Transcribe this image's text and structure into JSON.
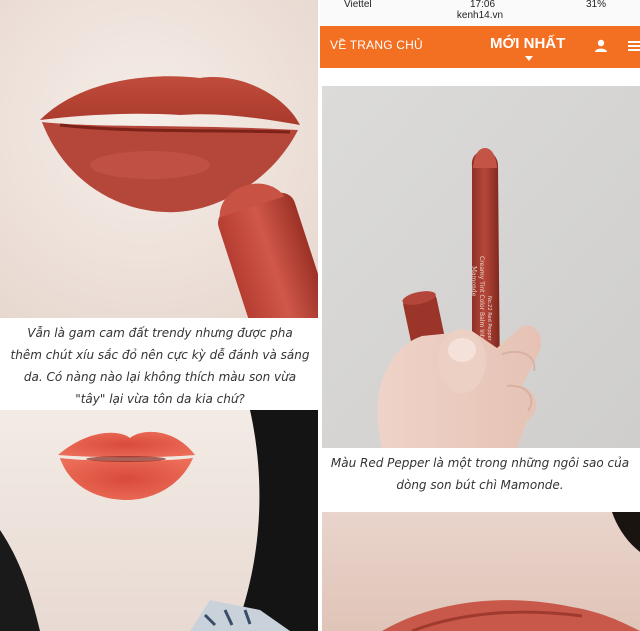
{
  "status_bar": {
    "carrier": "Viettel",
    "time": "17:06",
    "battery": "31%"
  },
  "url_bar": {
    "domain": "kenh14.vn"
  },
  "nav": {
    "home_label": "VỀ TRANG CHỦ",
    "newest_label": "MỚI NHẤT",
    "user_icon": "user-icon",
    "menu_icon": "hamburger-menu-icon"
  },
  "captions": {
    "left": "Vẫn là gam cam đất trendy nhưng được pha thêm chút xíu sắc đỏ nên cực kỳ dễ đánh và sáng da. Có nàng nào lại không thích màu son vừa \"tây\" lại vừa tôn da kia chứ?",
    "right": "Màu Red Pepper là một trong những ngôi sao của dòng son bút chì Mamonde."
  },
  "product": {
    "brand": "Mamonde",
    "line": "Creamy Tint Color Balm Intense",
    "shade": "No.22 Red Pepper"
  },
  "colors": {
    "brand_orange": "#f36f21",
    "lip_red": "#b8483a",
    "lip_orange": "#e05a45"
  }
}
